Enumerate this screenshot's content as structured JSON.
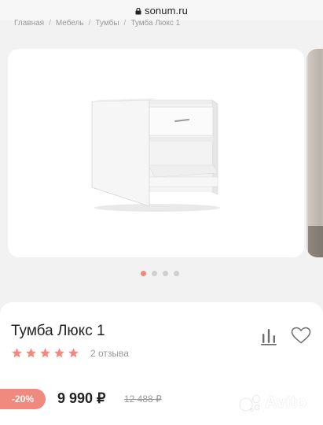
{
  "browser": {
    "url": "sonum.ru",
    "lock_icon": "lock-icon"
  },
  "breadcrumbs": [
    {
      "label": "Главная"
    },
    {
      "label": "Мебель"
    },
    {
      "label": "Тумбы"
    },
    {
      "label": "Тумба Люкс 1"
    }
  ],
  "breadcrumb_separator": "/",
  "gallery": {
    "image": "bedside-table-image",
    "dots_count": 4,
    "active_dot": 0
  },
  "product": {
    "title": "Тумба Люкс 1",
    "rating": 5,
    "reviews": "2 отзыва",
    "discount": "-20%",
    "price": "9 990 ₽",
    "old_price": "12 488 ₽",
    "compare_icon": "compare-bars-icon",
    "favorite_icon": "heart-icon"
  },
  "watermark": {
    "text": "Avito"
  },
  "colors": {
    "accent": "#f08a7e",
    "star": "#f08a7e",
    "muted_text": "#9a9a9a"
  }
}
